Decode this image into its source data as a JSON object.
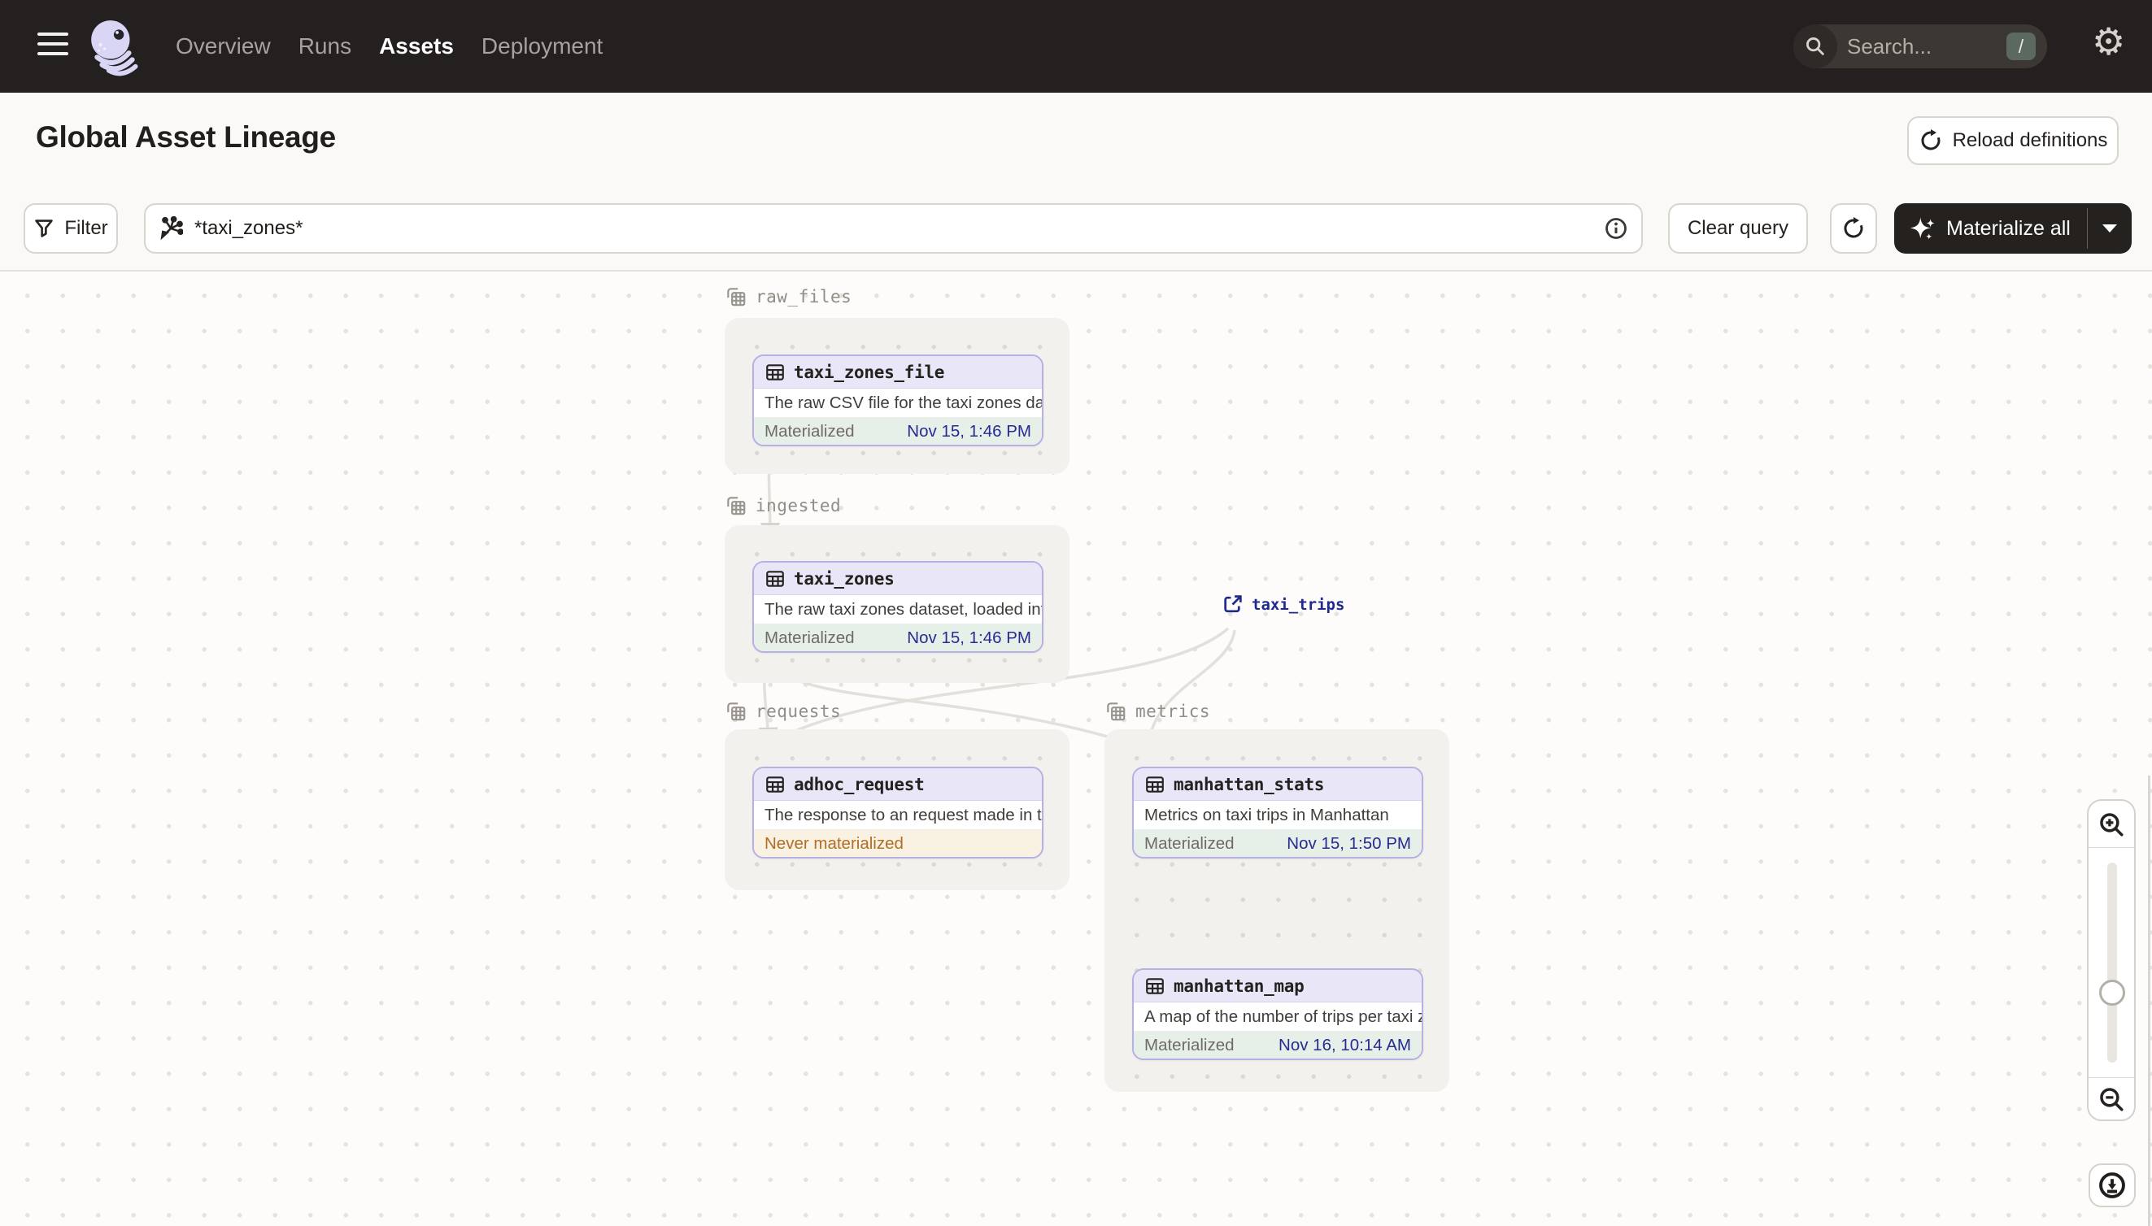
{
  "header": {
    "nav": [
      {
        "label": "Overview",
        "active": false
      },
      {
        "label": "Runs",
        "active": false
      },
      {
        "label": "Assets",
        "active": true
      },
      {
        "label": "Deployment",
        "active": false
      }
    ],
    "search": {
      "placeholder": "Search...",
      "shortcut": "/"
    },
    "icons": {
      "menu": "hamburger-icon",
      "logo": "dagster-octopus-logo",
      "search": "search-icon",
      "settings": "gear-icon"
    }
  },
  "page": {
    "title": "Global Asset Lineage",
    "reload_button": "Reload definitions"
  },
  "toolbar": {
    "filter_button": "Filter",
    "query": {
      "value": "*taxi_zones*",
      "icon": "asset-selector-icon",
      "info_icon": "info-icon"
    },
    "clear_button": "Clear query",
    "refresh_icon": "refresh-icon",
    "materialize_button": "Materialize all",
    "materialize_icon": "sparkle-icon"
  },
  "graph": {
    "external_asset": {
      "name": "taxi_trips",
      "icon": "external-link-icon"
    },
    "groups": [
      {
        "name": "raw_files",
        "nodes": [
          {
            "name": "taxi_zones_file",
            "description": "The raw CSV file for the taxi zones dat...",
            "status": "Materialized",
            "timestamp": "Nov 15, 1:46 PM",
            "status_type": "materialized"
          }
        ]
      },
      {
        "name": "ingested",
        "nodes": [
          {
            "name": "taxi_zones",
            "description": "The raw taxi zones dataset, loaded int...",
            "status": "Materialized",
            "timestamp": "Nov 15, 1:46 PM",
            "status_type": "materialized"
          }
        ]
      },
      {
        "name": "requests",
        "nodes": [
          {
            "name": "adhoc_request",
            "description": "The response to an request made in th...",
            "status": "Never materialized",
            "timestamp": "",
            "status_type": "never"
          }
        ]
      },
      {
        "name": "metrics",
        "nodes": [
          {
            "name": "manhattan_stats",
            "description": "Metrics on taxi trips in Manhattan",
            "status": "Materialized",
            "timestamp": "Nov 15, 1:50 PM",
            "status_type": "materialized"
          },
          {
            "name": "manhattan_map",
            "description": "A map of the number of trips per taxi z...",
            "status": "Materialized",
            "timestamp": "Nov 16, 10:14 AM",
            "status_type": "materialized"
          }
        ]
      }
    ],
    "edges": [
      "taxi_zones_file->taxi_zones",
      "taxi_zones->adhoc_request",
      "taxi_zones->manhattan_stats",
      "taxi_trips->adhoc_request",
      "taxi_trips->manhattan_stats",
      "manhattan_stats->manhattan_map"
    ]
  },
  "zoom_controls": {
    "zoom_in_icon": "magnifier-plus-icon",
    "zoom_out_icon": "magnifier-minus-icon",
    "download_icon": "download-icon"
  },
  "colors": {
    "header_bg": "#242020",
    "node_border": "#b6b0e3",
    "node_header_bg": "#e9e6f8",
    "materialized_bg": "#e6efe8",
    "never_materialized_bg": "#f9f1e2",
    "never_materialized_text": "#b16e24",
    "timestamp_text": "#272c90",
    "external_asset_text": "#1e2a8c",
    "edge": "#e3e0dc"
  }
}
